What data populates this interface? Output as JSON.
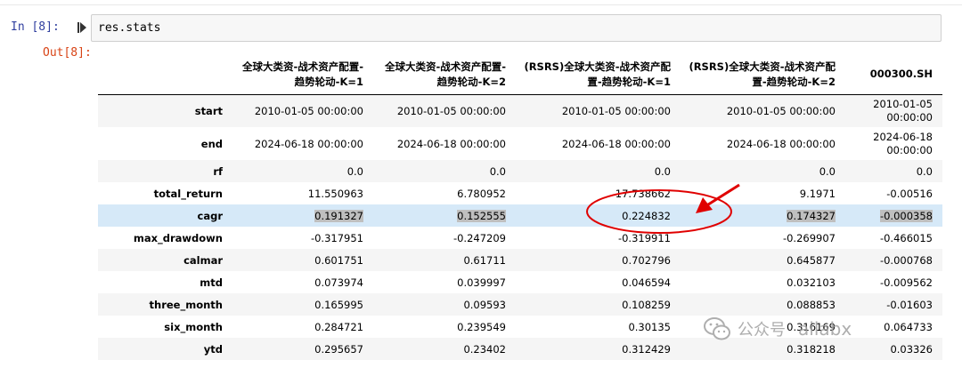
{
  "input_cell": {
    "prompt": "In  [8]:",
    "code": "res.stats"
  },
  "output_cell": {
    "prompt": "Out[8]:"
  },
  "table": {
    "columns": [
      "",
      "全球大类资-战术资产配置-\n趋势轮动-K=1",
      "全球大类资-战术资产配置-\n趋势轮动-K=2",
      "(RSRS)全球大类资-战术资产配\n置-趋势轮动-K=1",
      "(RSRS)全球大类资-战术资产配\n置-趋势轮动-K=2",
      "000300.SH"
    ],
    "rows": [
      {
        "label": "start",
        "values": [
          "2010-01-05 00:00:00",
          "2010-01-05 00:00:00",
          "2010-01-05 00:00:00",
          "2010-01-05 00:00:00",
          "2010-01-05\n00:00:00"
        ]
      },
      {
        "label": "end",
        "values": [
          "2024-06-18 00:00:00",
          "2024-06-18 00:00:00",
          "2024-06-18 00:00:00",
          "2024-06-18 00:00:00",
          "2024-06-18\n00:00:00"
        ]
      },
      {
        "label": "rf",
        "values": [
          "0.0",
          "0.0",
          "0.0",
          "0.0",
          "0.0"
        ]
      },
      {
        "label": "total_return",
        "values": [
          "11.550963",
          "6.780952",
          "17.738662",
          "9.1971",
          "-0.00516"
        ]
      },
      {
        "label": "cagr",
        "values": [
          "0.191327",
          "0.152555",
          "0.224832",
          "0.174327",
          "-0.000358"
        ]
      },
      {
        "label": "max_drawdown",
        "values": [
          "-0.317951",
          "-0.247209",
          "-0.319911",
          "-0.269907",
          "-0.466015"
        ]
      },
      {
        "label": "calmar",
        "values": [
          "0.601751",
          "0.61711",
          "0.702796",
          "0.645877",
          "-0.000768"
        ]
      },
      {
        "label": "mtd",
        "values": [
          "0.073974",
          "0.039997",
          "0.046594",
          "0.032103",
          "-0.009562"
        ]
      },
      {
        "label": "three_month",
        "values": [
          "0.165995",
          "0.09593",
          "0.108259",
          "0.088853",
          "-0.01603"
        ]
      },
      {
        "label": "six_month",
        "values": [
          "0.284721",
          "0.239549",
          "0.30135",
          "0.316169",
          "0.064733"
        ]
      },
      {
        "label": "ytd",
        "values": [
          "0.295657",
          "0.23402",
          "0.312429",
          "0.318218",
          "0.03326"
        ]
      }
    ]
  },
  "watermark": {
    "text1": "公众号",
    "text2": "ailabx"
  },
  "colors": {
    "in_prompt": "#303f9f",
    "out_prompt": "#d84315",
    "annotation": "#e00000",
    "selected_row": "#d6e9f8"
  },
  "icons": {
    "run": "run-cell-icon",
    "watermark": "wechat-icon"
  }
}
